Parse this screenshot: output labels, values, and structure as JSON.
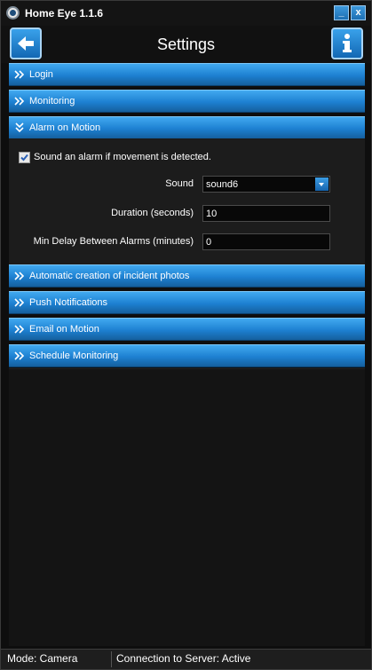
{
  "window": {
    "title": "Home Eye 1.1.6",
    "minimize_icon": "_",
    "close_icon": "x"
  },
  "header": {
    "title": "Settings",
    "back_icon": "arrow-left-icon",
    "info_icon": "info-icon"
  },
  "sections": [
    {
      "label": "Login",
      "expanded": false
    },
    {
      "label": "Monitoring",
      "expanded": false
    },
    {
      "label": "Alarm on Motion",
      "expanded": true
    },
    {
      "label": "Automatic creation of incident photos",
      "expanded": false
    },
    {
      "label": "Push Notifications",
      "expanded": false
    },
    {
      "label": "Email on Motion",
      "expanded": false
    },
    {
      "label": "Schedule Monitoring",
      "expanded": false
    }
  ],
  "alarm": {
    "checkbox_label": "Sound an alarm if movement is detected.",
    "checked": true,
    "sound_label": "Sound",
    "sound_value": "sound6",
    "duration_label": "Duration (seconds)",
    "duration_value": "10",
    "delay_label": "Min Delay Between Alarms (minutes)",
    "delay_value": "0"
  },
  "status": {
    "mode": "Mode: Camera",
    "connection": "Connection to Server: Active"
  },
  "colors": {
    "accent": "#1d80d1",
    "background": "#0e0e0e"
  }
}
